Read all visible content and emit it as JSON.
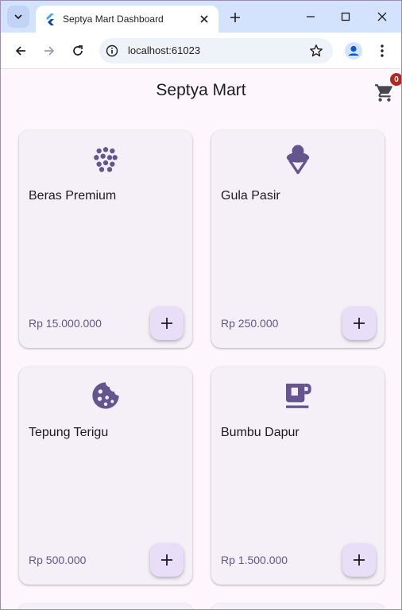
{
  "browser": {
    "tab_title": "Septya Mart Dashboard",
    "url": "localhost:61023"
  },
  "app": {
    "title": "Septya Mart",
    "cart_count": "0"
  },
  "products": [
    {
      "name": "Beras Premium",
      "price": "Rp 15.000.000",
      "icon": "grain-icon"
    },
    {
      "name": "Gula Pasir",
      "price": "Rp 250.000",
      "icon": "icecream-icon"
    },
    {
      "name": "Tepung Terigu",
      "price": "Rp 500.000",
      "icon": "cookie-icon"
    },
    {
      "name": "Bumbu Dapur",
      "price": "Rp 1.500.000",
      "icon": "coffee-cup-icon"
    }
  ],
  "colors": {
    "accent": "#65558f",
    "card_bg": "#f5eff7",
    "add_button_bg": "#e8def8",
    "badge": "#b3261e"
  }
}
